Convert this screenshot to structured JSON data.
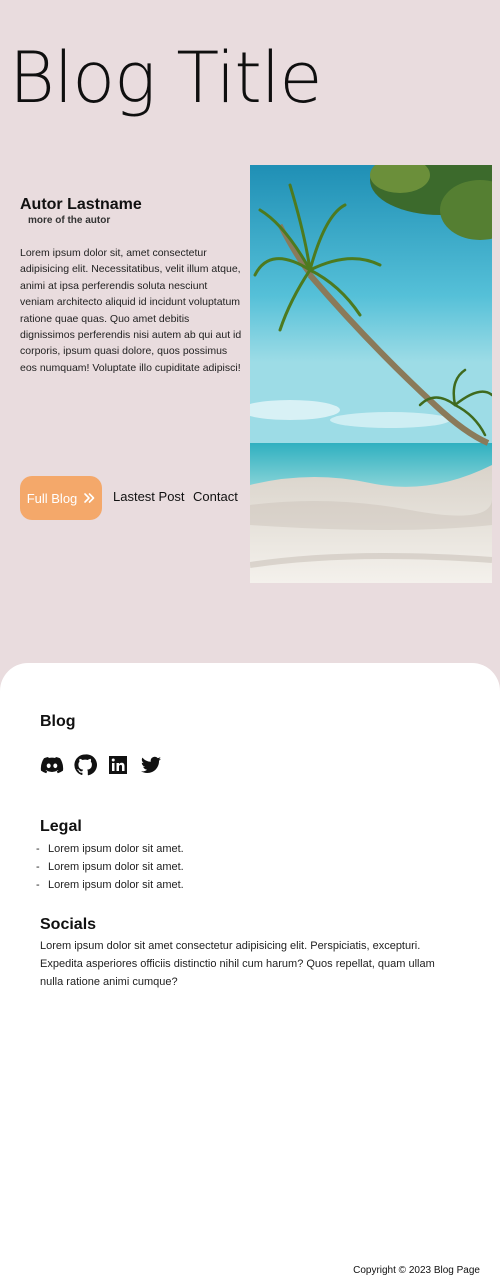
{
  "header": {
    "title": "Blog Title"
  },
  "author": {
    "name": "Autor Lastname",
    "subtitle": "more of the autor"
  },
  "post": {
    "excerpt": "Lorem ipsum dolor sit, amet consectetur adipisicing elit. Necessitatibus, velit illum atque, animi at ipsa perferendis soluta nesciunt veniam architecto aliquid id incidunt voluptatum ratione quae quas. Quo amet debitis dignissimos perferendis nisi autem ab qui aut id corporis, ipsum quasi dolore, quos possimus eos numquam! Voluptate illo cupiditate adipisci!"
  },
  "actions": {
    "full_blog_label": "Full Blog",
    "latest_post_label": "Lastest Post",
    "contact_label": "Contact"
  },
  "hero": {
    "image_icon": "palm-beach-photo"
  },
  "colors": {
    "background": "#e9dcde",
    "accent": "#f4a86a",
    "footer_bg": "#ffffff"
  },
  "footer": {
    "brand": "Blog",
    "social_icons": [
      "discord-icon",
      "github-icon",
      "linkedin-icon",
      "twitter-icon"
    ],
    "legal": {
      "heading": "Legal",
      "items": [
        "Lorem ipsum dolor sit amet.",
        "Lorem ipsum dolor sit amet.",
        "Lorem ipsum dolor sit amet."
      ]
    },
    "socials": {
      "heading": "Socials",
      "text": "Lorem ipsum dolor sit amet consectetur adipisicing elit. Perspiciatis, excepturi. Expedita asperiores officiis distinctio nihil cum harum? Quos repellat, quam ullam nulla ratione animi cumque?"
    },
    "copyright": "Copyright © 2023 Blog Page"
  }
}
